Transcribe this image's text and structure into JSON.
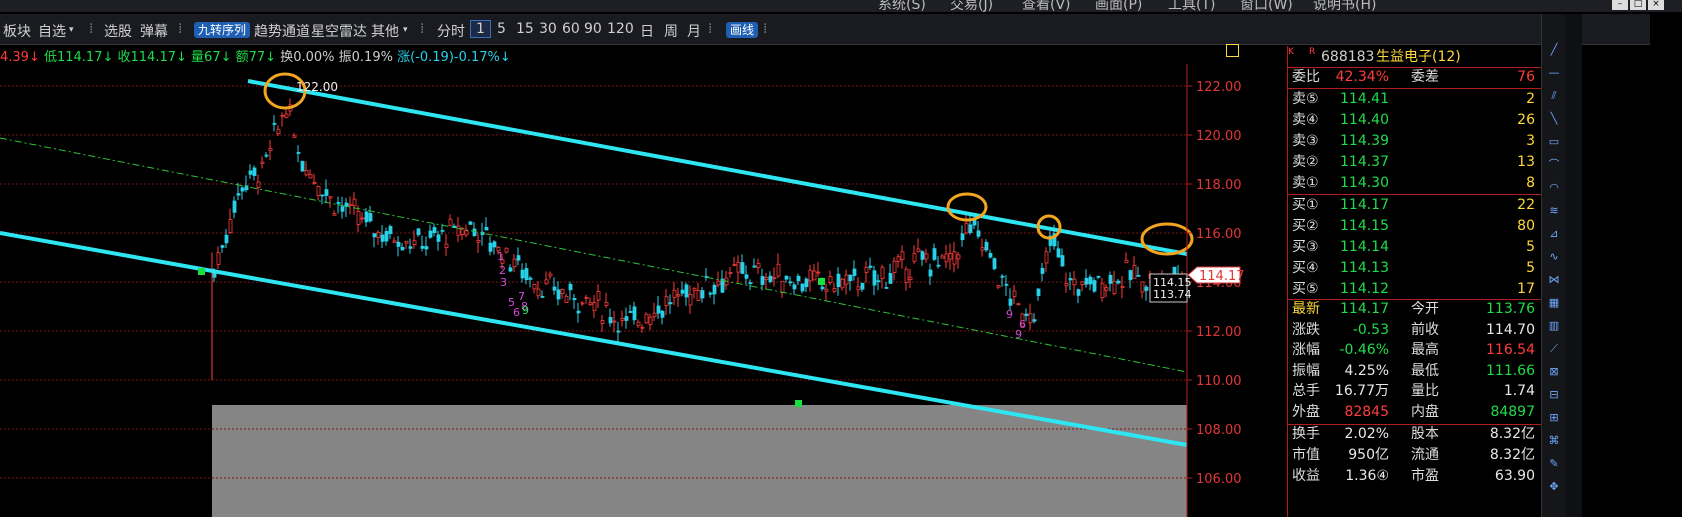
{
  "menu": [
    "系统(S)",
    "交易(J)",
    "查看(V)",
    "画面(P)",
    "工具(T)",
    "窗口(W)",
    "说明书(H)"
  ],
  "toolbar": {
    "items": [
      "板块",
      "自选",
      "选股",
      "弹幕"
    ],
    "active_tab": "九转序列",
    "items2": [
      "趋势通道",
      "星空雷达",
      "其他"
    ],
    "periods": [
      "分时",
      "1",
      "5",
      "15",
      "30",
      "60",
      "90",
      "120",
      "日",
      "周",
      "月"
    ],
    "selected_period": "1",
    "draw_button": "画线"
  },
  "infobar": {
    "seg1": "4.39↓",
    "seg2": "低114.17↓",
    "seg3": "收114.17↓",
    "seg4": "量67↓",
    "seg5": "额77↓",
    "seg6": "换0.00%",
    "seg7": "振0.19%",
    "seg8": "涨(-0.19)-0.17%↓"
  },
  "chart_data": {
    "type": "candlestick",
    "y_ticks": [
      "122.00",
      "120.00",
      "118.00",
      "116.00",
      "114.00",
      "112.00",
      "110.00",
      "108.00",
      "106.00"
    ],
    "ylim": [
      105.6,
      123.3
    ],
    "peak_label": "122.00",
    "current_price_label": "114.17",
    "bid_ask_labels": [
      "114.15",
      "113.74"
    ],
    "td_sequence_numbers": [
      "1",
      "2",
      "3",
      "5",
      "6",
      "7",
      "8",
      "9"
    ],
    "colors": {
      "up": "#ff3d3d",
      "down": "#27d2e9",
      "channel": "#2ee6f2",
      "midline": "#2fc23a",
      "highlight": "#f3a521"
    }
  },
  "panel": {
    "code": "688183",
    "name": "生益电子(12)",
    "k_badge": "K",
    "r_badge": "R",
    "weibi_label": "委比",
    "weibi_value": "42.34%",
    "weicha_label": "委差",
    "weicha_value": "76",
    "sells": [
      {
        "label": "卖⑤",
        "price": "114.41",
        "vol": "2"
      },
      {
        "label": "卖④",
        "price": "114.40",
        "vol": "26"
      },
      {
        "label": "卖③",
        "price": "114.39",
        "vol": "3"
      },
      {
        "label": "卖②",
        "price": "114.37",
        "vol": "13"
      },
      {
        "label": "卖①",
        "price": "114.30",
        "vol": "8"
      }
    ],
    "buys": [
      {
        "label": "买①",
        "price": "114.17",
        "vol": "22"
      },
      {
        "label": "买②",
        "price": "114.15",
        "vol": "80"
      },
      {
        "label": "买③",
        "price": "114.14",
        "vol": "5"
      },
      {
        "label": "买④",
        "price": "114.13",
        "vol": "5"
      },
      {
        "label": "买⑤",
        "price": "114.12",
        "vol": "17"
      }
    ],
    "stats": [
      {
        "l1": "最新",
        "v1": "114.17",
        "c1": "green",
        "l2": "今开",
        "v2": "113.76",
        "c2": "green"
      },
      {
        "l1": "涨跌",
        "v1": "-0.53",
        "c1": "green",
        "l2": "前收",
        "v2": "114.70",
        "c2": "white"
      },
      {
        "l1": "涨幅",
        "v1": "-0.46%",
        "c1": "green",
        "l2": "最高",
        "v2": "116.54",
        "c2": "red"
      },
      {
        "l1": "振幅",
        "v1": "4.25%",
        "c1": "white",
        "l2": "最低",
        "v2": "111.66",
        "c2": "green"
      },
      {
        "l1": "总手",
        "v1": "16.77万",
        "c1": "white",
        "l2": "量比",
        "v2": "1.74",
        "c2": "white"
      },
      {
        "l1": "外盘",
        "v1": "82845",
        "c1": "red",
        "l2": "内盘",
        "v2": "84897",
        "c2": "green"
      }
    ],
    "stats2": [
      {
        "l1": "换手",
        "v1": "2.02%",
        "c1": "white",
        "l2": "股本",
        "v2": "8.32亿",
        "c2": "white"
      },
      {
        "l1": "市值",
        "v1": "950亿",
        "c1": "white",
        "l2": "流通",
        "v2": "8.32亿",
        "c2": "white"
      },
      {
        "l1": "收益",
        "v1": "1.36④",
        "c1": "white",
        "l2": "市盈",
        "v2": "63.90",
        "c2": "white"
      }
    ]
  }
}
